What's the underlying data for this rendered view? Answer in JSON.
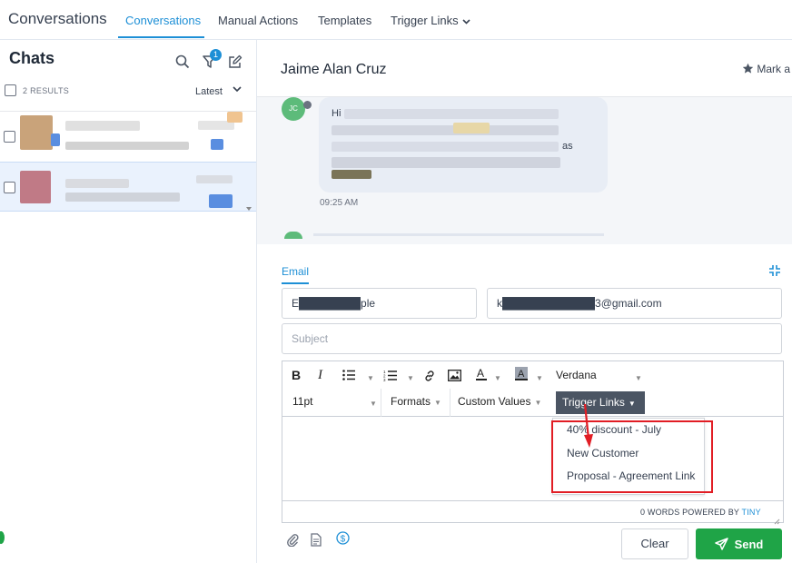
{
  "app": {
    "title": "Conversations"
  },
  "nav": {
    "tabs": [
      {
        "label": "Conversations"
      },
      {
        "label": "Manual Actions"
      },
      {
        "label": "Templates"
      },
      {
        "label": "Trigger Links"
      }
    ]
  },
  "sidebar": {
    "title": "Chats",
    "badge_count": "1",
    "results": "2 RESULTS",
    "sort_label": "Latest"
  },
  "conversation": {
    "contact_name": "Jaime Alan Cruz",
    "mark_label": "Mark a",
    "avatar_initials": "JC",
    "message_greeting": "Hi",
    "message_time": "09:25 AM"
  },
  "composer": {
    "channel_tab": "Email",
    "from_value": "E████████ple",
    "to_value": "k████████████3@gmail.com",
    "subject_placeholder": "Subject",
    "toolbar": {
      "font_family": "Verdana",
      "font_size": "11pt",
      "formats": "Formats",
      "custom_values": "Custom Values",
      "trigger_links": "Trigger Links"
    },
    "trigger_links_options": [
      "40% discount - July",
      "New Customer",
      "Proposal - Agreement Link"
    ],
    "word_count": "0 WORDS POWERED BY",
    "powered_by": "TINY",
    "clear_label": "Clear",
    "send_label": "Send"
  },
  "colors": {
    "accent": "#1d8fd6",
    "send": "#1fa447",
    "highlight": "#e11d24"
  }
}
